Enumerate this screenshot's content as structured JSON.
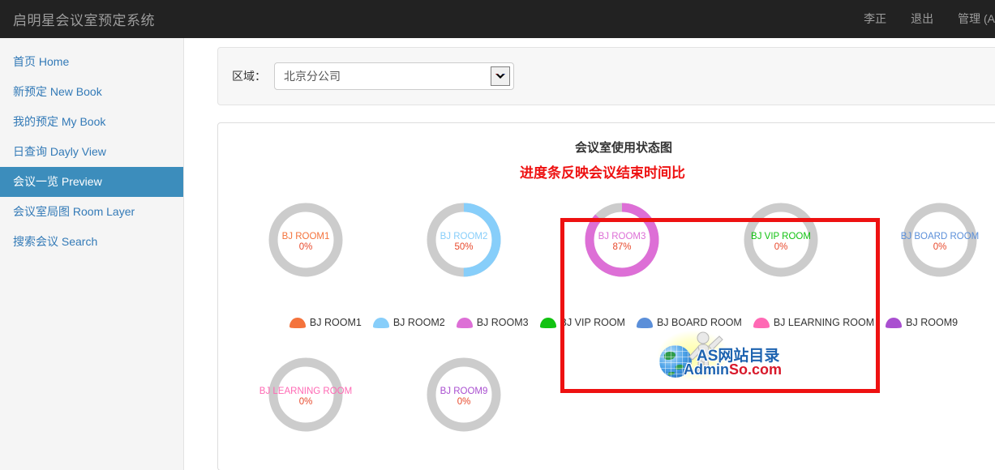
{
  "topbar": {
    "brand": "启明星会议室预定系统",
    "links": [
      {
        "name": "user-name",
        "label": "李正"
      },
      {
        "name": "logout",
        "label": "退出"
      },
      {
        "name": "admin",
        "label": "管理 (A"
      }
    ]
  },
  "sidebar": {
    "items": [
      {
        "label": "首页 Home",
        "name": "sidebar-item-home",
        "active": false
      },
      {
        "label": "新预定 New Book",
        "name": "sidebar-item-new-book",
        "active": false
      },
      {
        "label": "我的预定 My Book",
        "name": "sidebar-item-my-book",
        "active": false
      },
      {
        "label": "日查询 Dayly View",
        "name": "sidebar-item-dayly-view",
        "active": false
      },
      {
        "label": "会议一览 Preview",
        "name": "sidebar-item-preview",
        "active": true
      },
      {
        "label": "会议室局图 Room Layer",
        "name": "sidebar-item-room-layer",
        "active": false
      },
      {
        "label": "搜索会议 Search",
        "name": "sidebar-item-search",
        "active": false
      }
    ]
  },
  "filter": {
    "label": "区域：",
    "selected": "北京分公司"
  },
  "annotation": {
    "text": "进度条反映会议结束时间比",
    "color": "#ee1111"
  },
  "watermark": {
    "line1": "AS网站目录",
    "line2_blue": "Admin",
    "line2_red": "So.com"
  },
  "chart_data": {
    "type": "pie",
    "title": "会议室使用状态图",
    "legend_position": "center-middle",
    "track_color": "#cccccc",
    "percent_text_color": "#e8492c",
    "categories": [
      "BJ ROOM1",
      "BJ ROOM2",
      "BJ ROOM3",
      "BJ VIP ROOM",
      "BJ BOARD ROOM",
      "BJ LEARNING ROOM",
      "BJ ROOM9"
    ],
    "values": [
      0,
      50,
      87,
      0,
      0,
      0,
      0
    ],
    "colors": [
      "#f4733c",
      "#87cefa",
      "#dd6fd6",
      "#11c211",
      "#5b8fd9",
      "#ff69b4",
      "#a94fd0"
    ],
    "donuts": [
      {
        "label": "BJ ROOM1",
        "pct_label": "0%",
        "value": 0,
        "color": "#f4733c",
        "name": "donut-bj-room1"
      },
      {
        "label": "BJ ROOM2",
        "pct_label": "50%",
        "value": 50,
        "color": "#87cefa",
        "name": "donut-bj-room2"
      },
      {
        "label": "BJ ROOM3",
        "pct_label": "87%",
        "value": 87,
        "color": "#dd6fd6",
        "name": "donut-bj-room3"
      },
      {
        "label": "BJ VIP ROOM",
        "pct_label": "0%",
        "value": 0,
        "color": "#11c211",
        "name": "donut-bj-vip-room"
      },
      {
        "label": "BJ BOARD ROOM",
        "pct_label": "0%",
        "value": 0,
        "color": "#5b8fd9",
        "name": "donut-bj-board-room"
      },
      {
        "label": "BJ LEARNING ROOM",
        "pct_label": "0%",
        "value": 0,
        "color": "#ff69b4",
        "name": "donut-bj-learning-room"
      },
      {
        "label": "BJ ROOM9",
        "pct_label": "0%",
        "value": 0,
        "color": "#a94fd0",
        "name": "donut-bj-room9"
      }
    ],
    "legend": [
      {
        "label": "BJ ROOM1",
        "color": "#f4733c"
      },
      {
        "label": "BJ ROOM2",
        "color": "#87cefa"
      },
      {
        "label": "BJ ROOM3",
        "color": "#dd6fd6"
      },
      {
        "label": "BJ VIP ROOM",
        "color": "#11c211"
      },
      {
        "label": "BJ BOARD ROOM",
        "color": "#5b8fd9"
      },
      {
        "label": "BJ LEARNING ROOM",
        "color": "#ff69b4"
      },
      {
        "label": "BJ ROOM9",
        "color": "#a94fd0"
      }
    ]
  }
}
